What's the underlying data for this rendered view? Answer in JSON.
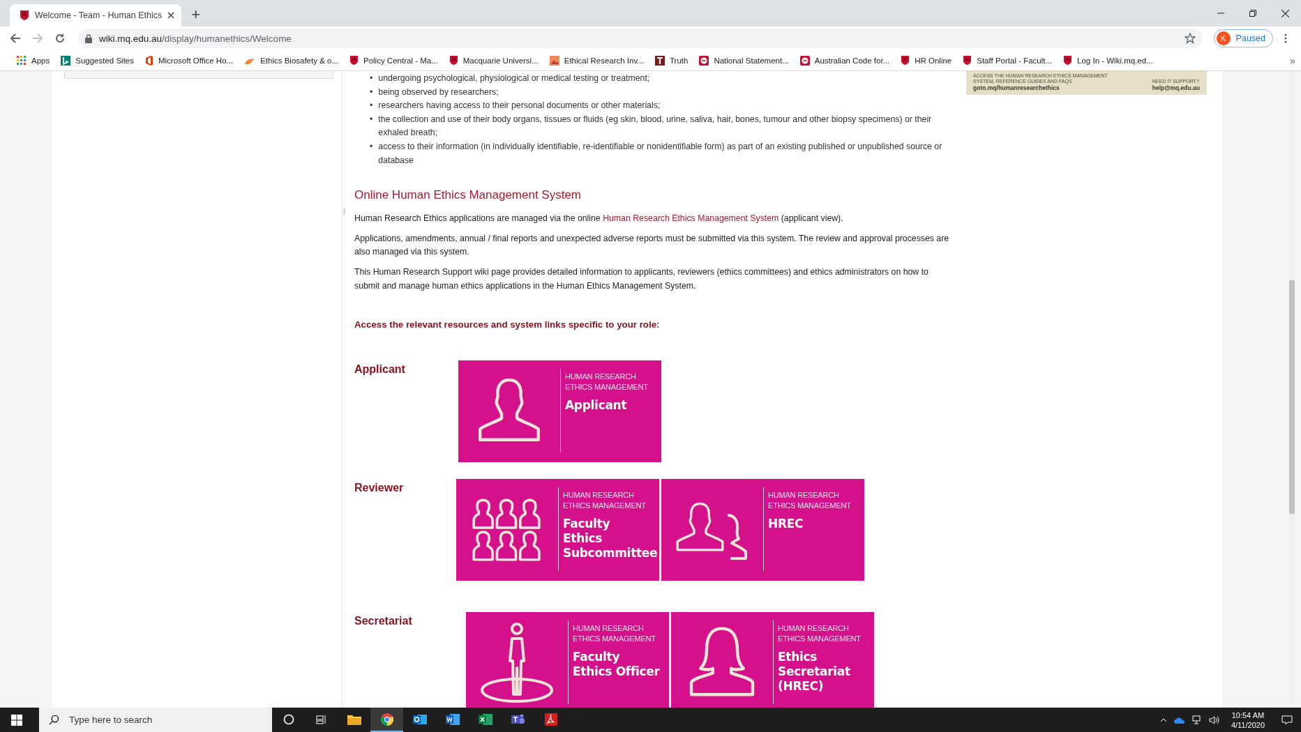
{
  "browser": {
    "tab": {
      "title": "Welcome - Team - Human Ethics",
      "selected": true
    },
    "new_tab": "+",
    "address": {
      "host": "wiki.mq.edu.au",
      "path": "/display/humanethics/Welcome"
    },
    "profile": {
      "initial": "K",
      "status": "Paused"
    },
    "overflow": "»"
  },
  "bookmarks": [
    {
      "label": "Apps",
      "kind": "grid"
    },
    {
      "label": "Suggested Sites",
      "kind": "bing"
    },
    {
      "label": "Microsoft Office Ho...",
      "kind": "office"
    },
    {
      "label": "Ethics Biosafety & o...",
      "kind": "waves"
    },
    {
      "label": "Policy Central - Ma...",
      "kind": "shield"
    },
    {
      "label": "Macquarie Universi...",
      "kind": "shield"
    },
    {
      "label": "Ethical Research Inv...",
      "kind": "photo"
    },
    {
      "label": "Truth",
      "kind": "letter"
    },
    {
      "label": "National Statement...",
      "kind": "stop"
    },
    {
      "label": "Australian Code for...",
      "kind": "stop"
    },
    {
      "label": "HR Online",
      "kind": "shield"
    },
    {
      "label": "Staff Portal - Facult...",
      "kind": "shield"
    },
    {
      "label": "Log In - Wiki.mq.ed...",
      "kind": "shield"
    }
  ],
  "page": {
    "bullets": [
      {
        "marker": "•",
        "text": "undergoing psychological, physiological or medical testing or treatment;"
      },
      {
        "marker": "•",
        "text": "being observed by researchers;"
      },
      {
        "marker": "•",
        "text": "researchers having access to their personal documents or other materials;"
      },
      {
        "marker": "•",
        "text": "the collection and use of their body organs, tissues or fluids (eg skin, blood, urine, saliva, hair, bones, tumour and other biopsy specimens) or their exhaled breath;"
      },
      {
        "marker": "•",
        "text": "access to their information (in individually identifiable, re-identifiable or nonidentifiable form) as part of an existing published or unpublished source or database"
      }
    ],
    "heading": "Online Human Ethics Management System",
    "intro": {
      "before": "Human Research Ethics applications are managed via the online ",
      "link": "Human Research Ethics Management System",
      "after": " (applicant view)."
    },
    "paragraphs": [
      "Applications, amendments, annual / final reports and unexpected adverse reports must be submitted via this system.  The review and approval processes are also managed via this system.",
      "This Human Research Support wiki page provides detailed information to applicants, reviewers (ethics committees) and ethics administrators on how to submit and manage human ethics applications in the Human Ethics Management System."
    ],
    "prompt": "Access the relevant resources and system links specific to your role:",
    "banner": {
      "caption": "ACCESS THE HUMAN RESEARCH ETHICS MANAGEMENT SYSTEM, REFERENCE GUIDES AND FAQS",
      "link": "goto.mq/humanresearchethics",
      "support_label": "NEED IT SUPPORT?",
      "support_email": "help@mq.edu.au"
    },
    "roles": [
      {
        "name": "Applicant",
        "tiles": [
          {
            "kind": "person",
            "overline": "HUMAN RESEARCH\nETHICS MANAGEMENT",
            "title": "Applicant"
          }
        ]
      },
      {
        "name": "Reviewer",
        "tiles": [
          {
            "kind": "group",
            "overline": "HUMAN RESEARCH\nETHICS MANAGEMENT",
            "title": "Faculty\nEthics\nSubcommittee"
          },
          {
            "kind": "pair",
            "overline": "HUMAN RESEARCH\nETHICS MANAGEMENT",
            "title": "HREC"
          }
        ]
      },
      {
        "name": "Secretariat",
        "tiles": [
          {
            "kind": "standing",
            "overline": "HUMAN RESEARCH\nETHICS MANAGEMENT",
            "title": "Faculty\nEthics Officer"
          },
          {
            "kind": "woman",
            "overline": "HUMAN RESEARCH\nETHICS MANAGEMENT",
            "title": "Ethics\nSecretariat\n(HREC)"
          }
        ]
      }
    ]
  },
  "taskbar": {
    "search_placeholder": "Type here to search",
    "apps": [
      {
        "kind": "cortana",
        "selected": false
      },
      {
        "kind": "taskview",
        "selected": false
      },
      {
        "kind": "folder",
        "selected": false
      },
      {
        "kind": "chrome",
        "selected": true
      },
      {
        "kind": "outlook",
        "selected": false
      },
      {
        "kind": "word",
        "selected": false
      },
      {
        "kind": "excel",
        "selected": false
      },
      {
        "kind": "teams",
        "selected": false
      },
      {
        "kind": "pdf",
        "selected": false
      }
    ],
    "time": "10:54 AM",
    "date": "4/11/2020"
  }
}
